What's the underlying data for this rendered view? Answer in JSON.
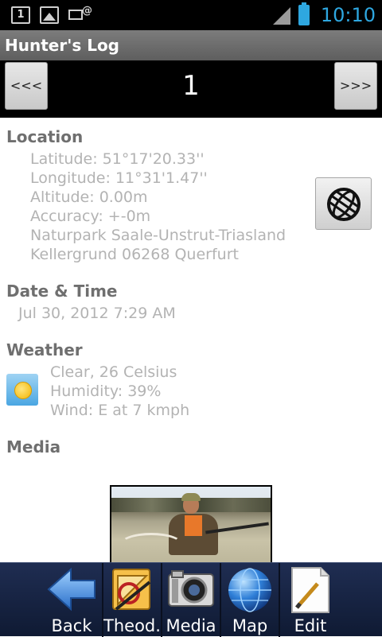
{
  "status_bar": {
    "notification_number": "1",
    "time": "10:10"
  },
  "app": {
    "title": "Hunter's Log"
  },
  "pager": {
    "prev_label": "<<<",
    "next_label": ">>>",
    "current_page": "1"
  },
  "location": {
    "heading": "Location",
    "latitude": "Latitude: 51°17'20.33''",
    "longitude": "Longitude: 11°31'1.47''",
    "altitude": "Altitude: 0.00m",
    "accuracy": "Accuracy: +-0m",
    "address_line1": "Naturpark Saale-Unstrut-Triasland",
    "address_line2": "Kellergrund 06268 Querfurt",
    "map_button_icon": "globe-grid-icon"
  },
  "datetime": {
    "heading": "Date & Time",
    "value": "Jul 30, 2012 7:29 AM"
  },
  "weather": {
    "heading": "Weather",
    "icon": "sunny-icon",
    "condition": "Clear, 26 Celsius",
    "humidity": "Humidity: 39%",
    "wind": "Wind: E at 7 kmph"
  },
  "media": {
    "heading": "Media",
    "photo": "hunter-with-deer-photo"
  },
  "toolbar": {
    "items": [
      {
        "label": "Back",
        "icon": "back-arrow-icon"
      },
      {
        "label": "Theod.",
        "icon": "theodolite-icon"
      },
      {
        "label": "Media",
        "icon": "camera-icon"
      },
      {
        "label": "Map",
        "icon": "globe-icon"
      },
      {
        "label": "Edit",
        "icon": "edit-page-icon"
      }
    ]
  },
  "colors": {
    "status_accent": "#2ea7e0",
    "title_bar": "#6b6b6b",
    "section_heading": "#6f6f6f",
    "detail_text": "#b3b3b3",
    "toolbar_bg": "#16223f"
  }
}
